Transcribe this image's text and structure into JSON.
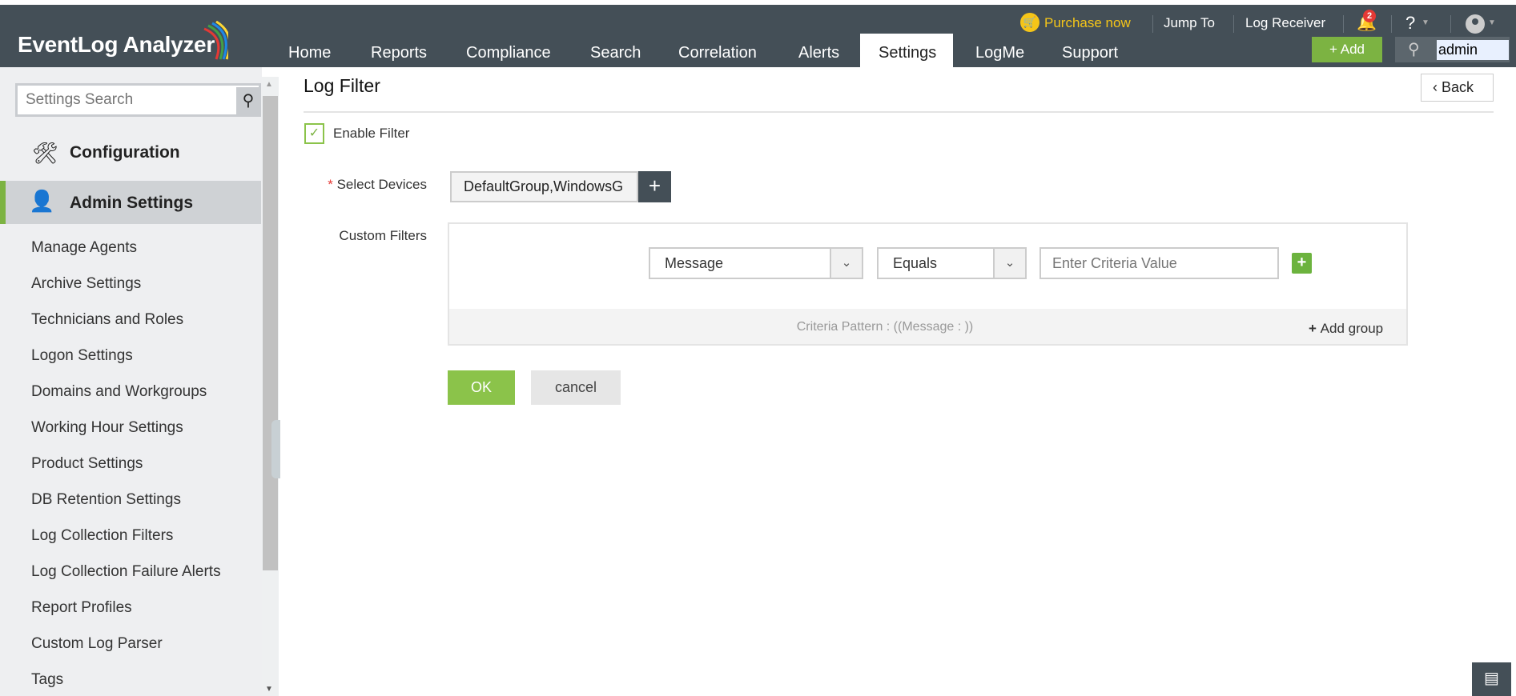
{
  "header": {
    "logo": "EventLog Analyzer",
    "purchase": "Purchase now",
    "jump_to": "Jump To",
    "log_receiver": "Log Receiver",
    "notif_count": "2",
    "help": "?",
    "add": "Add",
    "search_value": "admin",
    "nav": [
      "Home",
      "Reports",
      "Compliance",
      "Search",
      "Correlation",
      "Alerts",
      "Settings",
      "LogMe",
      "Support"
    ]
  },
  "sidebar": {
    "search_placeholder": "Settings Search",
    "configuration": "Configuration",
    "admin_settings": "Admin Settings",
    "items": [
      "Manage Agents",
      "Archive Settings",
      "Technicians and Roles",
      "Logon Settings",
      "Domains and Workgroups",
      "Working Hour Settings",
      "Product Settings",
      "DB Retention Settings",
      "Log Collection Filters",
      "Log Collection Failure Alerts",
      "Report Profiles",
      "Custom Log Parser",
      "Tags"
    ]
  },
  "main": {
    "title": "Log Filter",
    "back": "Back",
    "enable_filter": "Enable Filter",
    "required_mark": "*",
    "select_devices_label": "Select Devices",
    "devices_value": "DefaultGroup,WindowsG",
    "custom_filters_label": "Custom Filters",
    "field_select": "Message",
    "operator_select": "Equals",
    "criteria_placeholder": "Enter Criteria Value",
    "criteria_pattern": "Criteria Pattern : ((Message : ))",
    "add_group": "Add group",
    "ok": "OK",
    "cancel": "cancel"
  },
  "colors": {
    "header": "#444f57",
    "accent": "#7cb342",
    "purchase": "#f5c518"
  }
}
